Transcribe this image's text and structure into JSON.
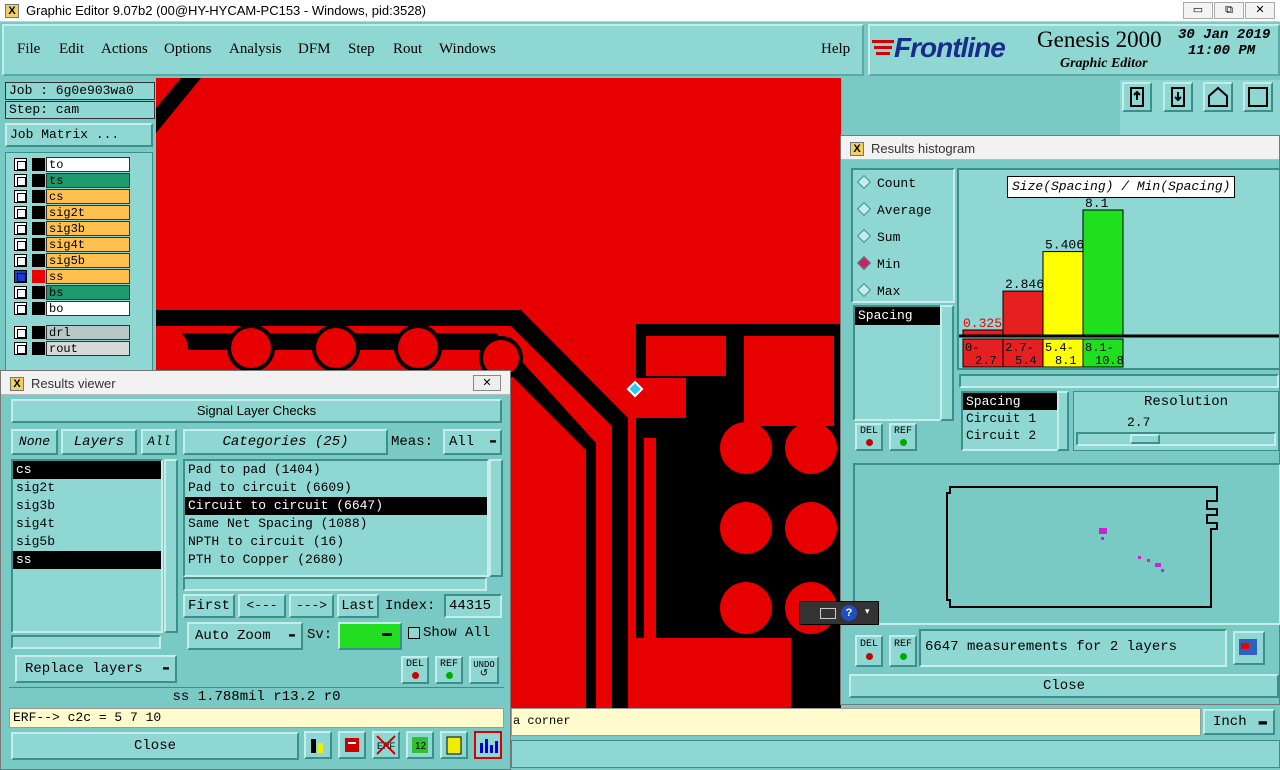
{
  "window": {
    "title": "Graphic Editor 9.07b2 (00@HY-HYCAM-PC153 - Windows, pid:3528)",
    "min": "▭",
    "max": "⧉",
    "close": "✕"
  },
  "menu": {
    "items": [
      "File",
      "Edit",
      "Actions",
      "Options",
      "Analysis",
      "DFM",
      "Step",
      "Rout",
      "Windows"
    ],
    "help": "Help"
  },
  "brand": {
    "logo": "Frontline",
    "product": "Genesis 2000",
    "subtitle": "Graphic Editor",
    "date": "30 Jan 2019",
    "time": "11:00 PM"
  },
  "job": {
    "job_label": "Job : 6g0e903wa0",
    "step_label": "Step: cam",
    "matrix_button": "Job Matrix ..."
  },
  "layers": [
    {
      "name": "to",
      "color": "#ffffff"
    },
    {
      "name": "ts",
      "color": "#1f9a6e"
    },
    {
      "name": "cs",
      "color": "#ffc04d"
    },
    {
      "name": "sig2t",
      "color": "#ffc04d"
    },
    {
      "name": "sig3b",
      "color": "#ffc04d"
    },
    {
      "name": "sig4t",
      "color": "#ffc04d"
    },
    {
      "name": "sig5b",
      "color": "#ffc04d"
    },
    {
      "name": "ss",
      "color": "#ffc04d"
    },
    {
      "name": "bs",
      "color": "#1f9a6e"
    },
    {
      "name": "bo",
      "color": "#ffffff"
    },
    {
      "name": "drl",
      "color": "#b8c8c8"
    },
    {
      "name": "rout",
      "color": "#d8d8d8"
    }
  ],
  "results_viewer": {
    "title": "Results viewer",
    "header": "Signal Layer Checks",
    "none": "None",
    "layers_btn": "Layers",
    "all": "All",
    "categories_btn": "Categories (25)",
    "meas_label": "Meas:",
    "meas_value": "All",
    "layer_list": [
      "cs",
      "sig2t",
      "sig3b",
      "sig4t",
      "sig5b",
      "ss"
    ],
    "categories": [
      "Pad to pad (1404)",
      "Pad to circuit (6609)",
      "Circuit to circuit (6647)",
      "Same Net Spacing (1088)",
      "NPTH to circuit (16)",
      "PTH to Copper (2680)"
    ],
    "nav": {
      "first": "First",
      "prev": "<---",
      "next": "--->",
      "last": "Last",
      "index_label": "Index:",
      "index_value": "44315"
    },
    "zoom": "Auto Zoom",
    "sv": "Sv:",
    "show_all": "Show All",
    "replace": "Replace layers",
    "del": "DEL",
    "ref": "REF",
    "undo": "UNDO",
    "info": "ss 1.788mil r13.2 r0",
    "erf": "ERF--> c2c = 5 7 10",
    "close": "Close"
  },
  "histogram": {
    "title": "Results histogram",
    "modes": [
      "Count",
      "Average",
      "Sum",
      "Min",
      "Max"
    ],
    "selected_mode": "Min",
    "chart_title": "Size(Spacing) / Min(Spacing)",
    "list_item": "Spacing",
    "res_list": [
      "Spacing",
      "Circuit 1",
      "Circuit 2"
    ],
    "resolution_label": "Resolution",
    "resolution_value": "2.7",
    "summary": "6647 measurements for 2 layers",
    "close": "Close",
    "del": "DEL",
    "ref": "REF"
  },
  "chart_data": {
    "type": "bar",
    "title": "Size(Spacing) / Min(Spacing)",
    "categories": [
      "0-\n2.7",
      "2.7-\n5.4",
      "5.4-\n8.1",
      "8.1-\n10.8"
    ],
    "values": [
      0.325,
      2.846,
      5.406,
      8.1
    ],
    "value_labels": [
      "0.325",
      "2.846",
      "5.406",
      "8.1"
    ],
    "colors": [
      "#e62020",
      "#e62020",
      "#ffff00",
      "#1ee01e"
    ],
    "ylim": [
      0,
      8.1
    ]
  },
  "status": {
    "message": "a corner",
    "unit": "Inch"
  }
}
